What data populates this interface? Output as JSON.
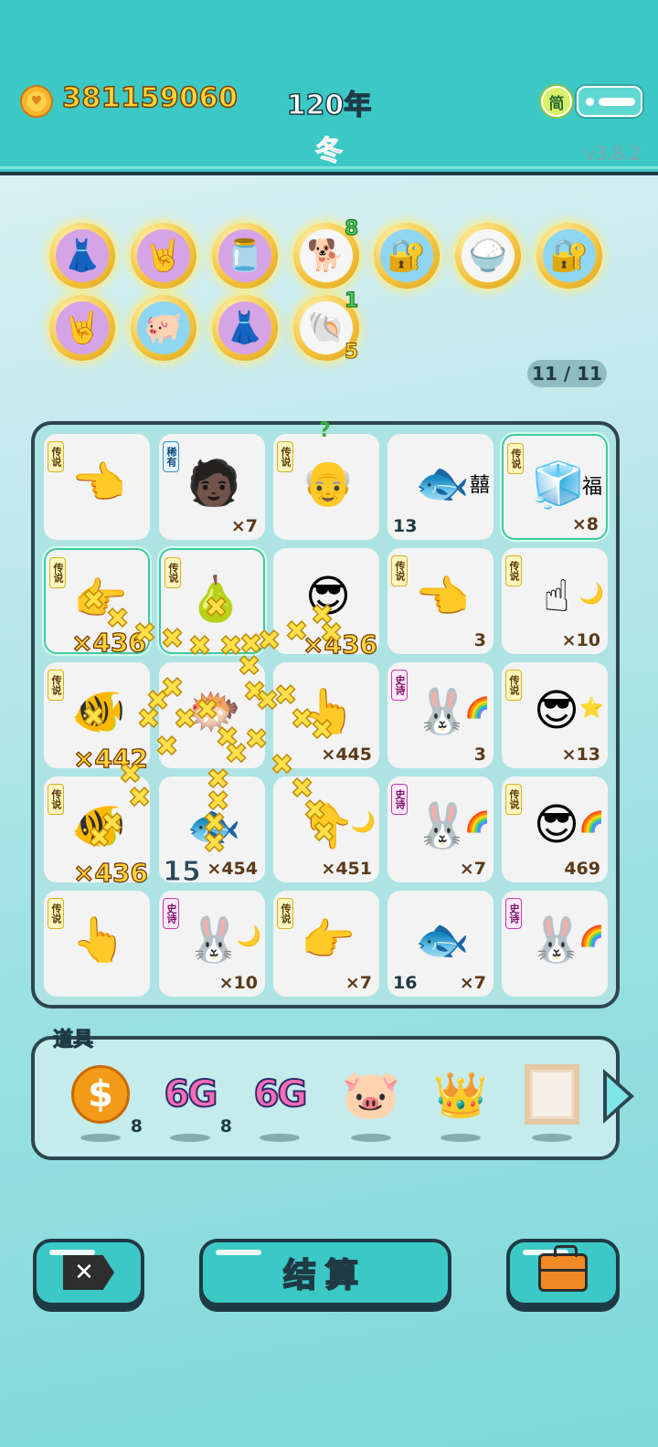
{
  "header": {
    "coins": "381159060",
    "year": "120年",
    "season": "冬",
    "lang_label": "简",
    "version": "v3.8.2"
  },
  "collection": {
    "badges": [
      {
        "icon": "skirt-icon",
        "glyph": "👗"
      },
      {
        "icon": "rock-hand-icon",
        "glyph": "🤘"
      },
      {
        "icon": "jar-icon",
        "glyph": "🫙"
      },
      {
        "icon": "husky-dog-icon",
        "glyph": "🐕",
        "count_top": "8"
      },
      {
        "icon": "safe-icon",
        "glyph": "🔐"
      },
      {
        "icon": "mirror-bowls-icon",
        "glyph": "🍚"
      },
      {
        "icon": "safe-icon",
        "glyph": "🔐"
      },
      {
        "icon": "rock-hand-icon",
        "glyph": "🤘"
      },
      {
        "icon": "piggy-bank-icon",
        "glyph": "🐖"
      },
      {
        "icon": "skirt-icon",
        "glyph": "👗"
      },
      {
        "icon": "shell-icon",
        "glyph": "🐚",
        "count_top": "1",
        "count_bottom": "5"
      }
    ],
    "progress": "11 / 11"
  },
  "board": {
    "cells": [
      {
        "tag": "传说",
        "tag_type": "legend",
        "icon": "pointing-hand-icon",
        "glyph": "👈"
      },
      {
        "tag": "稀有",
        "tag_type": "rare",
        "icon": "bucket-hat-person-icon",
        "glyph": "🧑🏿",
        "mult": "×7"
      },
      {
        "tag": "传说",
        "tag_type": "legend",
        "icon": "bald-glasses-man-icon",
        "glyph": "👴",
        "question": "?"
      },
      {
        "tag": "",
        "tag_type": "none",
        "icon": "fish-icon",
        "glyph": "🐟",
        "side": "囍",
        "count": "13"
      },
      {
        "tag": "传说",
        "tag_type": "legend",
        "icon": "fridge-icon",
        "glyph": "🧊",
        "side": "福",
        "mult": "×8",
        "highlight": true
      },
      {
        "tag": "传说",
        "tag_type": "legend",
        "icon": "pointing-hand-icon",
        "glyph": "👉",
        "mult": "×436",
        "big": true,
        "highlight": true
      },
      {
        "tag": "传说",
        "tag_type": "legend",
        "icon": "pomelo-icon",
        "glyph": "🍐",
        "highlight": true
      },
      {
        "tag": "",
        "tag_type": "none",
        "icon": "sunglasses-man-icon",
        "glyph": "😎",
        "mult": "×436",
        "big": true
      },
      {
        "tag": "传说",
        "tag_type": "legend",
        "icon": "pointing-hand-icon",
        "glyph": "👈",
        "mult": "3"
      },
      {
        "tag": "传说",
        "tag_type": "legend",
        "icon": "pointing-hand-icon",
        "glyph": "☝",
        "side": "🌙",
        "mult": "×10"
      },
      {
        "tag": "传说",
        "tag_type": "legend",
        "icon": "koi-fish-icon",
        "glyph": "🐠",
        "mult": "×442",
        "big": true
      },
      {
        "tag": "",
        "tag_type": "none",
        "icon": "fish-bowl-icon",
        "glyph": "🐡"
      },
      {
        "tag": "",
        "tag_type": "none",
        "icon": "pointing-hand-icon",
        "glyph": "👆",
        "mult": "×445"
      },
      {
        "tag": "史诗",
        "tag_type": "epic",
        "icon": "rabbit-house-icon",
        "glyph": "🐰",
        "side": "🌈",
        "mult": "3"
      },
      {
        "tag": "传说",
        "tag_type": "legend",
        "icon": "sunglasses-man-icon",
        "glyph": "😎",
        "side": "⭐",
        "mult": "×13"
      },
      {
        "tag": "传说",
        "tag_type": "legend",
        "icon": "koi-fish-icon",
        "glyph": "🐠",
        "mult": "×436",
        "big": true
      },
      {
        "tag": "",
        "tag_type": "none",
        "icon": "fish-icon",
        "glyph": "🐟",
        "count": "15",
        "count_big": true,
        "mult": "×454"
      },
      {
        "tag": "",
        "tag_type": "none",
        "icon": "pointing-hand-icon",
        "glyph": "👇",
        "side": "🌙",
        "mult": "×451"
      },
      {
        "tag": "史诗",
        "tag_type": "epic",
        "icon": "rabbit-house-icon",
        "glyph": "🐰",
        "side": "🌈",
        "mult": "×7"
      },
      {
        "tag": "传说",
        "tag_type": "legend",
        "icon": "sunglasses-man-icon",
        "glyph": "😎",
        "side": "🌈",
        "mult": "469"
      },
      {
        "tag": "传说",
        "tag_type": "legend",
        "icon": "pointing-hand-icon",
        "glyph": "👆"
      },
      {
        "tag": "史诗",
        "tag_type": "epic",
        "icon": "rabbit-house-icon",
        "glyph": "🐰",
        "side": "🌙",
        "mult": "×10"
      },
      {
        "tag": "传说",
        "tag_type": "legend",
        "icon": "pointing-hand-icon",
        "glyph": "👉",
        "mult": "×7"
      },
      {
        "tag": "",
        "tag_type": "none",
        "icon": "fish-icon",
        "glyph": "🐟",
        "count": "16",
        "mult": "×7"
      },
      {
        "tag": "史诗",
        "tag_type": "epic",
        "icon": "rabbit-house-icon",
        "glyph": "🐰",
        "side": "🌈"
      }
    ]
  },
  "items": {
    "label": "道具",
    "list": [
      {
        "icon": "dollar-coin-icon",
        "qty": "8"
      },
      {
        "icon": "6g-icon",
        "text": "6G",
        "qty": "8"
      },
      {
        "icon": "6g-icon",
        "text": "6G"
      },
      {
        "icon": "piggy-bank-icon",
        "glyph": "🐷"
      },
      {
        "icon": "crown-icon",
        "glyph": "👑"
      },
      {
        "icon": "picture-frame-icon"
      }
    ]
  },
  "buttons": {
    "settle": "结算"
  },
  "colors": {
    "header_bg": "#3cc9c6",
    "outline": "#1e3a44",
    "coin_text": "#ffd43a",
    "season_text": "#ff3b5a"
  }
}
